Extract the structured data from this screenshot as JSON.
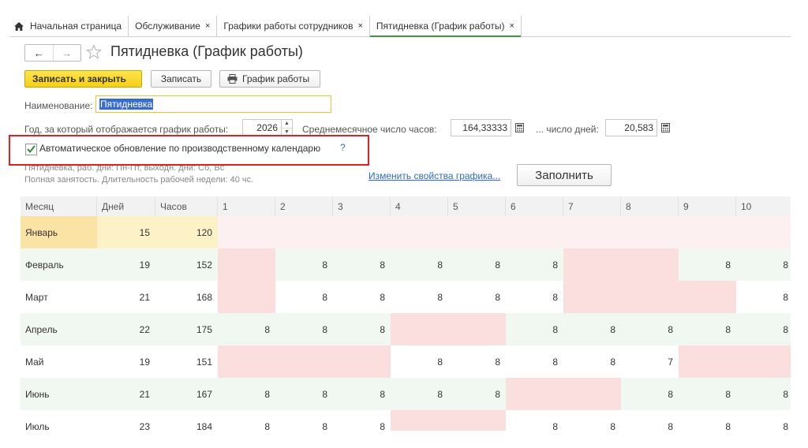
{
  "tabs": [
    {
      "label": "Начальная страница",
      "close": ""
    },
    {
      "label": "Обслуживание",
      "close": "×"
    },
    {
      "label": "Графики работы сотрудников",
      "close": "×"
    },
    {
      "label": "Пятидневка (График работы)",
      "close": "×"
    }
  ],
  "nav": {
    "back": "←",
    "forward": "→"
  },
  "title": "Пятидневка (График работы)",
  "toolbar": {
    "save_close": "Записать и закрыть",
    "save": "Записать",
    "schedule": "График работы"
  },
  "form": {
    "name_label": "Наименование:",
    "name_value": "Пятидневка",
    "year_label": "Год, за который отображается график работы:",
    "year_value": "2026",
    "avg_hours_label": "Среднемесячное число часов:",
    "avg_hours_value": "164,33333",
    "avg_days_label": "... число дней:",
    "avg_days_value": "20,583",
    "auto_update_label": "Автоматическое обновление по производственному календарю",
    "auto_update_checked": true,
    "help": "?",
    "desc_line1": "Пятидневка, раб. дни: Пн-Пт, выходн. дни: Сб, Вс",
    "desc_line2": "Полная занятость. Длительность рабочей недели: 40 чс.",
    "change_link": "Изменить свойства графика...",
    "fill_button": "Заполнить"
  },
  "grid": {
    "headers": [
      "Месяц",
      "Дней",
      "Часов",
      "1",
      "2",
      "3",
      "4",
      "5",
      "6",
      "7",
      "8",
      "9",
      "10"
    ],
    "rows": [
      {
        "month": "Январь",
        "days": "15",
        "hours": "120",
        "cells": [
          "",
          "",
          "",
          "",
          "",
          "",
          "",
          "",
          "",
          ""
        ],
        "types": [
          "j",
          "j",
          "j",
          "j",
          "j",
          "j",
          "j",
          "j",
          "j",
          "j"
        ]
      },
      {
        "month": "Февраль",
        "days": "19",
        "hours": "152",
        "cells": [
          "",
          "8",
          "8",
          "8",
          "8",
          "8",
          "",
          "",
          "8",
          "8"
        ],
        "types": [
          "h",
          "w",
          "w",
          "w",
          "w",
          "w",
          "h",
          "h",
          "w",
          "w"
        ]
      },
      {
        "month": "Март",
        "days": "21",
        "hours": "168",
        "cells": [
          "",
          "8",
          "8",
          "8",
          "8",
          "8",
          "",
          "",
          "",
          "8"
        ],
        "types": [
          "h",
          "w",
          "w",
          "w",
          "w",
          "w",
          "h",
          "h",
          "h",
          "w"
        ]
      },
      {
        "month": "Апрель",
        "days": "22",
        "hours": "175",
        "cells": [
          "8",
          "8",
          "8",
          "",
          "",
          "8",
          "8",
          "8",
          "8",
          "8"
        ],
        "types": [
          "w",
          "w",
          "w",
          "h",
          "h",
          "w",
          "w",
          "w",
          "w",
          "w"
        ]
      },
      {
        "month": "Май",
        "days": "19",
        "hours": "151",
        "cells": [
          "",
          "",
          "",
          "8",
          "8",
          "8",
          "8",
          "7",
          "",
          ""
        ],
        "types": [
          "h",
          "h",
          "h",
          "w",
          "w",
          "w",
          "w",
          "w",
          "h",
          "h"
        ]
      },
      {
        "month": "Июнь",
        "days": "21",
        "hours": "167",
        "cells": [
          "8",
          "8",
          "8",
          "8",
          "8",
          "",
          "",
          "8",
          "8",
          "8"
        ],
        "types": [
          "w",
          "w",
          "w",
          "w",
          "w",
          "h",
          "h",
          "w",
          "w",
          "w"
        ]
      },
      {
        "month": "Июль",
        "days": "23",
        "hours": "184",
        "cells": [
          "8",
          "8",
          "8",
          "",
          "",
          "8",
          "8",
          "8",
          "8",
          "8"
        ],
        "types": [
          "w",
          "w",
          "w",
          "h",
          "h",
          "w",
          "w",
          "w",
          "w",
          "w"
        ]
      }
    ]
  },
  "colors": {
    "primary_button": "#f5cf19",
    "holiday": "#fbdfdf",
    "selected_month": "#fbe3a6",
    "highlight_frame": "#e02020",
    "link": "#2c6cc4"
  },
  "icons": [
    "home-icon",
    "star-icon",
    "printer-icon",
    "calculator-icon",
    "checkmark-icon"
  ]
}
